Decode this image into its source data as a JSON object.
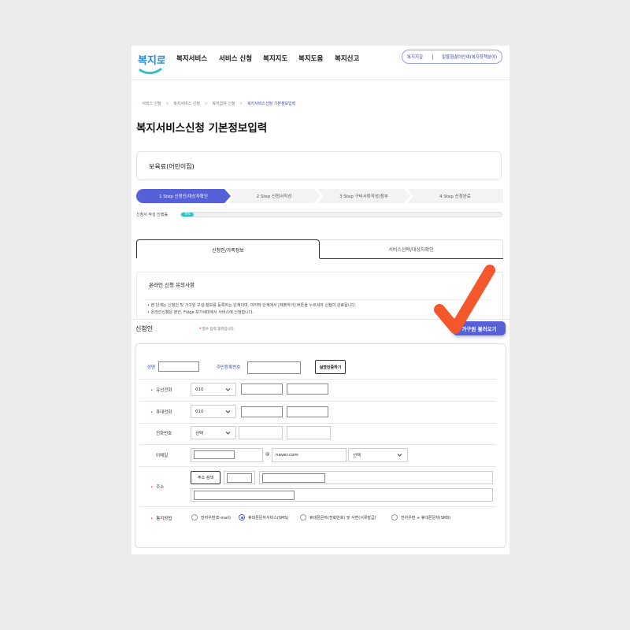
{
  "header": {
    "logo_text": "복지로",
    "nav": [
      "복지서비스",
      "서비스 신청",
      "복지지도",
      "복지도움",
      "복지신고"
    ],
    "util_links": [
      "복지지갑",
      "알뜰형결이안내(복지정책분야)"
    ]
  },
  "breadcrumb": [
    "서비스 신청",
    "복지서비스 신청",
    "복지급여 신청",
    "복지서비스신청 기본정보입력"
  ],
  "page_title": "복지서비스신청 기본정보입력",
  "service_name": "보육료(어린이집)",
  "steps": [
    "1 Step 신청인/대상자확인",
    "2 Step 신청서작성",
    "3 Step 구비서류작성/첨부",
    "4 Step 신청완료"
  ],
  "progress": {
    "label": "신청서 작성 진행률",
    "value": 0.04,
    "text": "0%"
  },
  "tabs": [
    "신청인/가족정보",
    "서비스선택/대상자확인"
  ],
  "notice": {
    "title": "온라인 신청 유의사항",
    "bullets": [
      "현 단계는 신청인 및 가구원 구성 정보를 등록하는 단계이며, 마지막 단계에서 [제출하기] 버튼을 누르셔야 신청이 완료됩니다.",
      "온라인신청은 본인, Fulge 보가세대에서 서비스에 신청합니다."
    ]
  },
  "applicant": {
    "title": "신청인",
    "required_note": "필수 입력 항목입니다.",
    "load_button": "가구원 불러오기"
  },
  "form": {
    "name_label": "성명",
    "rrn_label": "주민등록번호",
    "verify_button": "실명인증하기",
    "phone_label": "유선전화",
    "phone_prefix": "010",
    "mobile_label": "휴대전화",
    "mobile_prefix": "010",
    "tel_label": "전화번호",
    "tel_prefix": "선택",
    "email_label": "이메일",
    "email_at": "@",
    "email_domain": "naver.com",
    "email_select": "선택",
    "address_label": "주소",
    "address_button": "주소 검색",
    "notify_label": "통지방법",
    "notify_options": [
      {
        "label": "전자우편(E-mail)",
        "selected": false
      },
      {
        "label": "휴대폰문자서비스(SMS)",
        "selected": true
      },
      {
        "label": "휴대폰문자(전화번호) 및 서면(서류발급)",
        "selected": false
      },
      {
        "label": "전자우편 + 휴대폰문자(SMS)",
        "selected": false
      }
    ]
  },
  "colors": {
    "primary": "#5660d8",
    "progress": "#2ec1c8",
    "required": "#e0392b",
    "check": "#f4572b"
  }
}
